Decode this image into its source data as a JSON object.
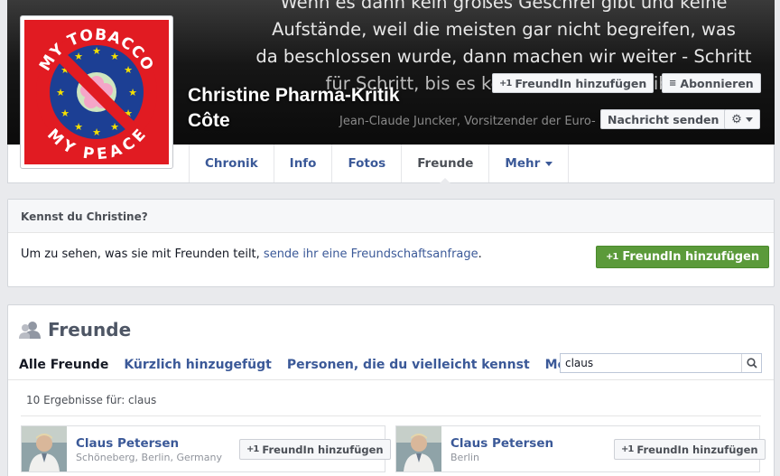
{
  "cover": {
    "quote_lines": [
      "Wenn es dann kein großes Geschrei gibt und keine",
      "Aufstände, weil die meisten gar nicht begreifen, was",
      "da beschlossen wurde, dann machen wir weiter - Schritt",
      "für Schritt, bis es kein Zurück mehr gibt."
    ],
    "source": "Jean-Claude Juncker, Vorsitzender der Euro-",
    "add_friend_label": "FreundIn hinzufügen",
    "subscribe_label": "Abonnieren",
    "message_label": "Nachricht senden"
  },
  "profile": {
    "name_line1": "Christine Pharma-Kritik",
    "name_line2": "Côte",
    "logo_top_text": "MY TOBACCO",
    "logo_bottom_text": "MY PEACE"
  },
  "nav": {
    "tabs": [
      {
        "label": "Chronik"
      },
      {
        "label": "Info"
      },
      {
        "label": "Fotos"
      },
      {
        "label": "Freunde"
      },
      {
        "label": "Mehr"
      }
    ]
  },
  "know": {
    "title": "Kennst du Christine?",
    "text_before": "Um zu sehen, was sie mit Freunden teilt, ",
    "link": "sende ihr eine Freundschaftsanfrage",
    "text_after": ".",
    "button": "FreundIn hinzufügen"
  },
  "friends": {
    "title": "Freunde",
    "tabs": [
      "Alle Freunde",
      "Kürzlich hinzugefügt",
      "Personen, die du vielleicht kennst",
      "Mehr"
    ],
    "search_value": "claus",
    "results_text": "10 Ergebnisse für: claus",
    "items": [
      {
        "name": "Claus Petersen",
        "location": "Schöneberg, Berlin, Germany",
        "button": "FreundIn hinzufügen"
      },
      {
        "name": "Claus Petersen",
        "location": "Berlin",
        "button": "FreundIn hinzufügen"
      }
    ]
  },
  "colors": {
    "link": "#3b5998",
    "green_button": "#5b9a3a",
    "logo_red": "#e11b22",
    "logo_blue": "#1c3f94",
    "logo_star": "#f4e000"
  }
}
